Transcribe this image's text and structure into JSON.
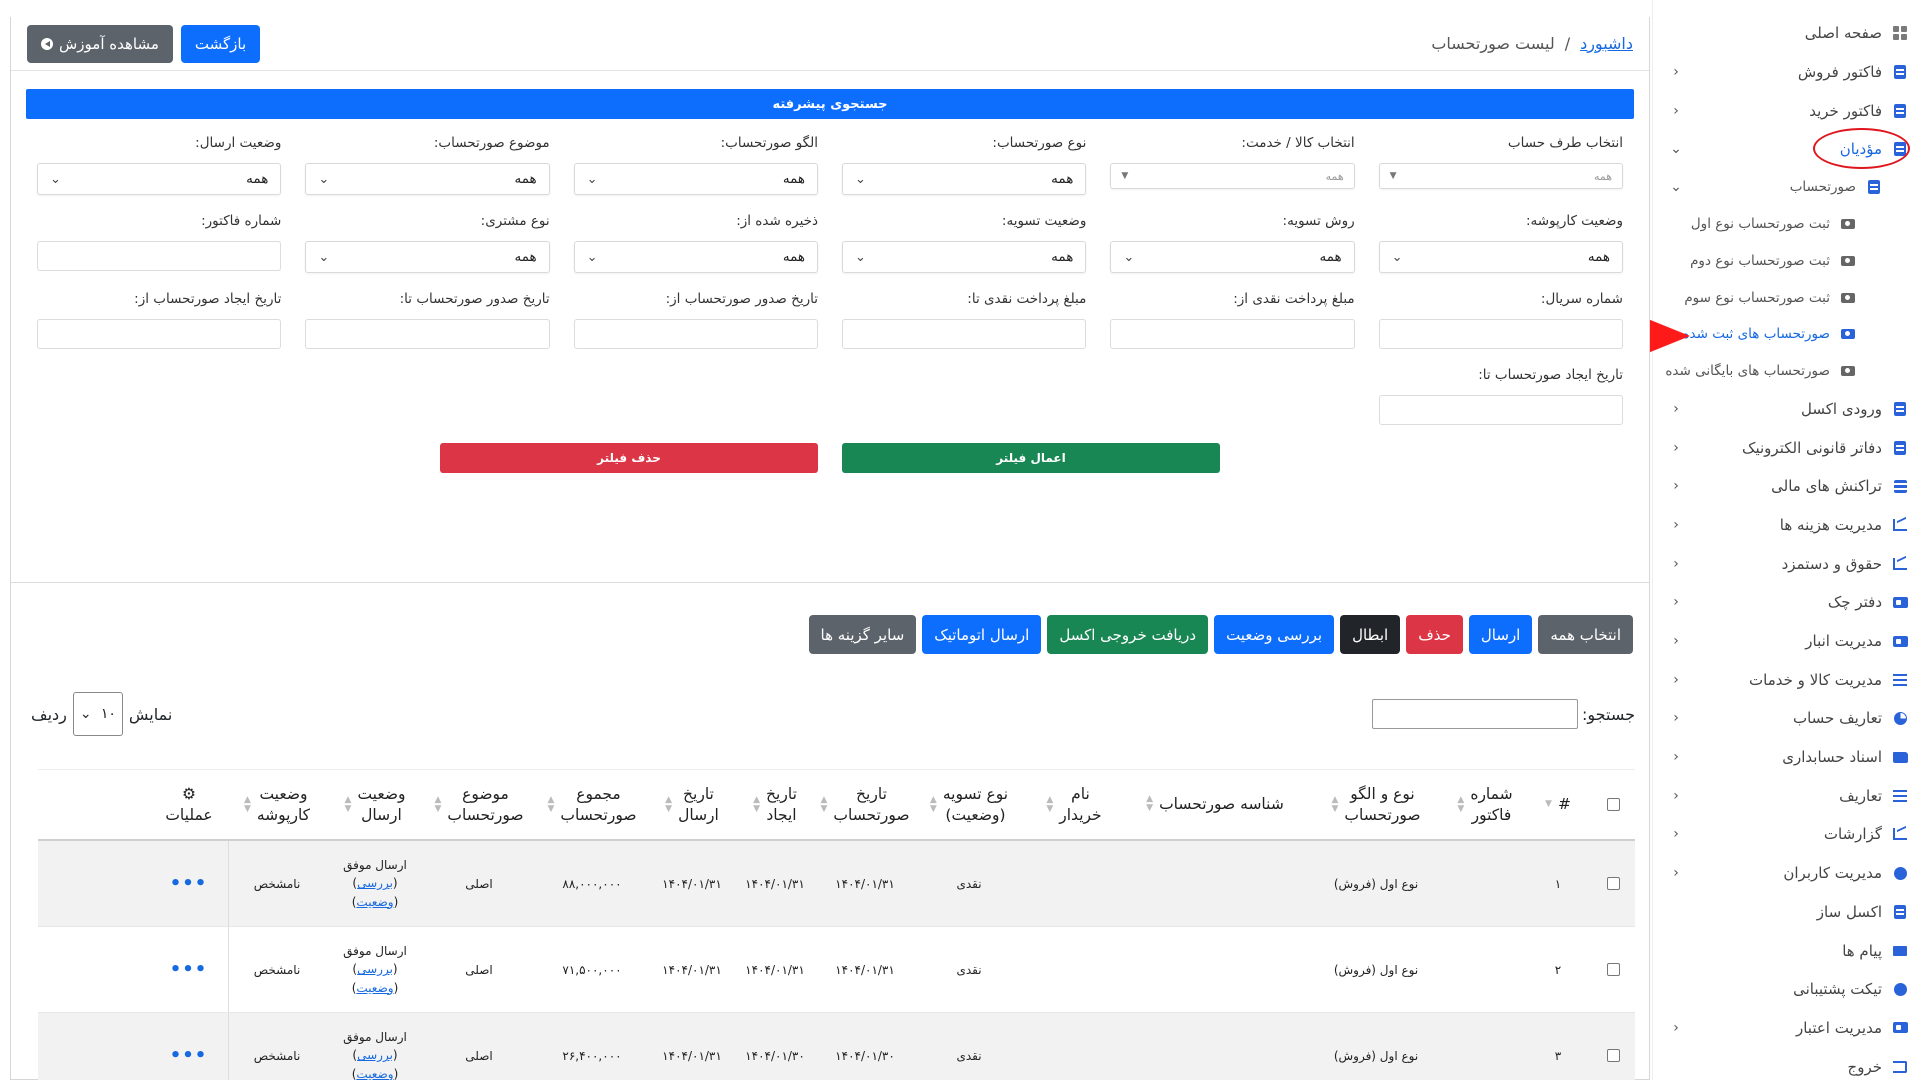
{
  "sidebar": {
    "items": [
      {
        "label": "صفحه اصلی",
        "icon": "home-icon",
        "chevron": ""
      },
      {
        "label": "فاکتور فروش",
        "icon": "document-icon",
        "chevron": "‹"
      },
      {
        "label": "فاکتور خرید",
        "icon": "document-icon",
        "chevron": "‹"
      },
      {
        "label": "مؤدیان",
        "icon": "document-icon",
        "chevron": "⌄"
      },
      {
        "label": "صورتحساب",
        "icon": "document-icon",
        "chevron": "⌄"
      },
      {
        "label": "ثبت صورتحساب نوع اول",
        "icon": "camera-icon",
        "chevron": ""
      },
      {
        "label": "ثبت صورتحساب نوع دوم",
        "icon": "camera-icon",
        "chevron": ""
      },
      {
        "label": "ثبت صورتحساب نوع سوم",
        "icon": "camera-icon",
        "chevron": ""
      },
      {
        "label": "صورتحساب های ثبت شده",
        "icon": "camera-icon",
        "chevron": ""
      },
      {
        "label": "صورتحساب های بایگانی شده",
        "icon": "camera-icon",
        "chevron": ""
      },
      {
        "label": "ورودی اکسل",
        "icon": "document-icon",
        "chevron": "‹"
      },
      {
        "label": "دفاتر قانونی الکترونیک",
        "icon": "book-icon",
        "chevron": "‹"
      },
      {
        "label": "تراکنش های مالی",
        "icon": "coins-icon",
        "chevron": "‹"
      },
      {
        "label": "مدیریت هزینه ها",
        "icon": "chart-icon",
        "chevron": "‹"
      },
      {
        "label": "حقوق و دستمزد",
        "icon": "chart-icon",
        "chevron": "‹"
      },
      {
        "label": "دفتر چک",
        "icon": "cheque-icon",
        "chevron": "‹"
      },
      {
        "label": "مدیریت انبار",
        "icon": "warehouse-icon",
        "chevron": "‹"
      },
      {
        "label": "مدیریت کالا و خدمات",
        "icon": "list-icon",
        "chevron": "‹"
      },
      {
        "label": "تعاریف حساب",
        "icon": "pie-icon",
        "chevron": "‹"
      },
      {
        "label": "اسناد حسابداری",
        "icon": "folder-icon",
        "chevron": "‹"
      },
      {
        "label": "تعاریف",
        "icon": "list-icon",
        "chevron": "‹"
      },
      {
        "label": "گزارشات",
        "icon": "chart-icon",
        "chevron": "‹"
      },
      {
        "label": "مدیریت کاربران",
        "icon": "users-icon",
        "chevron": "‹"
      },
      {
        "label": "اکسل ساز",
        "icon": "document-icon",
        "chevron": ""
      },
      {
        "label": "پیام ها",
        "icon": "envelope-icon",
        "chevron": ""
      },
      {
        "label": "تیکت پشتیبانی",
        "icon": "chat-icon",
        "chevron": ""
      },
      {
        "label": "مدیریت اعتبار",
        "icon": "credit-card-icon",
        "chevron": "‹"
      },
      {
        "label": "خروج",
        "icon": "exit-icon",
        "chevron": ""
      }
    ]
  },
  "header": {
    "breadcrumb_link": "داشبورد",
    "breadcrumb_sep": "/",
    "breadcrumb_current": "لیست صورتحساب",
    "back_label": "بازگشت",
    "tutorial_label": "مشاهده آموزش"
  },
  "advanced_search": "جستجوی پیشرفته",
  "filters": {
    "row1": [
      {
        "label": "انتخاب طرف حساب",
        "value": "همه"
      },
      {
        "label": "انتخاب کالا / خدمت:",
        "value": "همه"
      },
      {
        "label": "نوع صورتحساب:",
        "value": "همه"
      },
      {
        "label": "الگو صورتحساب:",
        "value": "همه"
      },
      {
        "label": "موضوع صورتحساب:",
        "value": "همه"
      },
      {
        "label": "وضعیت ارسال:",
        "value": "همه"
      }
    ],
    "row2": [
      {
        "label": "وضعیت کارپوشه:",
        "value": "همه"
      },
      {
        "label": "روش تسویه:",
        "value": "همه"
      },
      {
        "label": "وضعیت تسویه:",
        "value": "همه"
      },
      {
        "label": "ذخیره شده از:",
        "value": "همه"
      },
      {
        "label": "نوع مشتری:",
        "value": "همه"
      },
      {
        "label": "شماره فاکتور:",
        "value": ""
      }
    ],
    "row3": [
      {
        "label": "شماره سریال:"
      },
      {
        "label": "مبلغ پرداخت نقدی از:"
      },
      {
        "label": "مبلغ پرداخت نقدی تا:"
      },
      {
        "label": "تاریخ صدور صورتحساب از:"
      },
      {
        "label": "تاریخ صدور صورتحساب تا:"
      },
      {
        "label": "تاریخ ایجاد صورتحساب از:"
      }
    ],
    "row4": [
      {
        "label": "تاریخ ایجاد صورتحساب تا:"
      }
    ],
    "apply_label": "اعمال فیلتر",
    "clear_label": "حذف فیلتر"
  },
  "bulk_actions": {
    "select_all": "انتخاب همه",
    "send": "ارسال",
    "delete": "حذف",
    "cancel": "ابطال",
    "check_status": "بررسی وضعیت",
    "excel_export": "دریافت خروجی اکسل",
    "auto_send": "ارسال اتوماتیک",
    "more": "سایر گزینه ها"
  },
  "table_tools": {
    "search_label": "جستجو:",
    "show_label": "نمایش",
    "page_size": "۱۰",
    "rows_label": "ردیف"
  },
  "table": {
    "headers": {
      "num": "#",
      "invoice_no": [
        "شماره",
        "فاکتور"
      ],
      "type": [
        "نوع و الگو",
        "صورتحساب"
      ],
      "tax_id": "شناسه صورتحساب",
      "buyer": [
        "نام",
        "خریدار"
      ],
      "settlement": [
        "نوع تسویه",
        "(وضعیت)"
      ],
      "issue_date": [
        "تاریخ",
        "صورتحساب"
      ],
      "create_date": [
        "تاریخ",
        "ایجاد"
      ],
      "send_date": [
        "تاریخ",
        "ارسال"
      ],
      "total": [
        "مجموع",
        "صورتحساب"
      ],
      "subject": [
        "موضوع",
        "صورتحساب"
      ],
      "send_status": [
        "وضعیت",
        "ارسال"
      ],
      "cartable_status": [
        "وضعیت",
        "کارپوشه"
      ],
      "ops": "عملیات"
    },
    "rows": [
      {
        "num": "۱",
        "invoice_no": "",
        "type": "نوع اول (فروش)",
        "tax_id": "",
        "buyer": "",
        "settlement": "نقدی",
        "issue_date": "۱۴۰۴/۰۱/۳۱",
        "create_date": "۱۴۰۴/۰۱/۳۱",
        "send_date": "۱۴۰۴/۰۱/۳۱",
        "total": "۸۸,۰۰۰,۰۰۰",
        "subject": "اصلی",
        "send_status": "ارسال موفق",
        "review": "بررسی",
        "status_link": "وضعیت",
        "cartable": "نامشخص",
        "ops": "•••"
      },
      {
        "num": "۲",
        "invoice_no": "",
        "type": "نوع اول (فروش)",
        "tax_id": "",
        "buyer": "",
        "settlement": "نقدی",
        "issue_date": "۱۴۰۴/۰۱/۳۱",
        "create_date": "۱۴۰۴/۰۱/۳۱",
        "send_date": "۱۴۰۴/۰۱/۳۱",
        "total": "۷۱,۵۰۰,۰۰۰",
        "subject": "اصلی",
        "send_status": "ارسال موفق",
        "review": "بررسی",
        "status_link": "وضعیت",
        "cartable": "نامشخص",
        "ops": "•••"
      },
      {
        "num": "۳",
        "invoice_no": "",
        "type": "نوع اول (فروش)",
        "tax_id": "",
        "buyer": "",
        "settlement": "نقدی",
        "issue_date": "۱۴۰۴/۰۱/۳۰",
        "create_date": "۱۴۰۴/۰۱/۳۰",
        "send_date": "۱۴۰۴/۰۱/۳۱",
        "total": "۲۶,۴۰۰,۰۰۰",
        "subject": "اصلی",
        "send_status": "ارسال موفق",
        "review": "بررسی",
        "status_link": "وضعیت",
        "cartable": "نامشخص",
        "ops": "•••"
      }
    ]
  },
  "colors": {
    "primary": "#0d6efd",
    "danger": "#dc3545",
    "success": "#198754",
    "secondary": "#5c636a",
    "dark": "#212529",
    "annotation_red": "#e0161e"
  }
}
